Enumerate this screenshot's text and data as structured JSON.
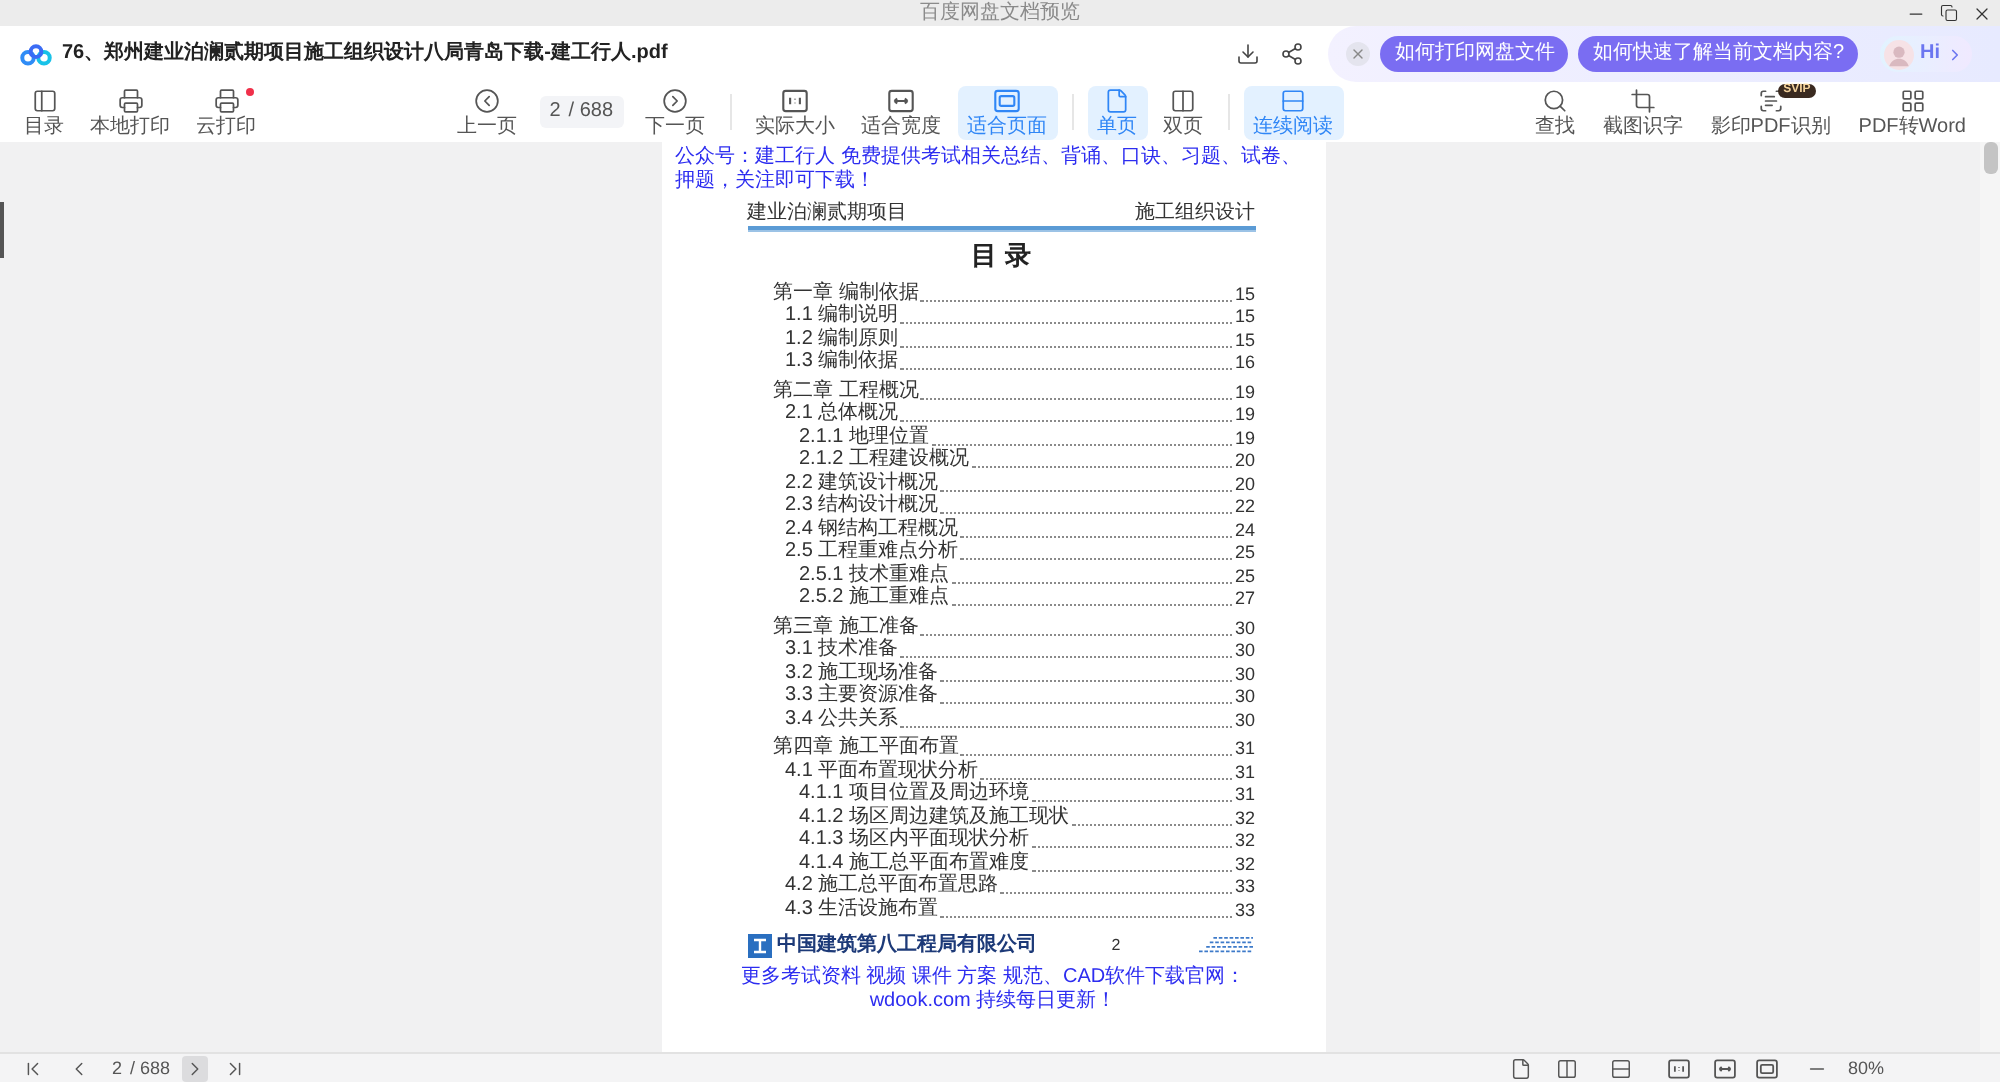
{
  "window": {
    "title": "百度网盘文档预览"
  },
  "header": {
    "file_name": "76、郑州建业泊澜贰期项目施工组织设计八局青岛下载-建工行人.pdf",
    "assistant": {
      "suggestions": [
        "如何打印网盘文件",
        "如何快速了解当前文档内容?"
      ],
      "greeting": "Hi"
    }
  },
  "toolbar": {
    "left": [
      {
        "label": "目录",
        "notification": false
      },
      {
        "label": "本地打印",
        "notification": false
      },
      {
        "label": "云打印",
        "notification": true
      }
    ],
    "navigation": {
      "previous": "上一页",
      "page": "2",
      "total": "/ 688",
      "next": "下一页"
    },
    "fit_modes": [
      {
        "label": "实际大小",
        "selected": false
      },
      {
        "label": "适合宽度",
        "selected": false
      },
      {
        "label": "适合页面",
        "selected": true
      }
    ],
    "page_modes": [
      {
        "label": "单页",
        "selected": true
      },
      {
        "label": "双页",
        "selected": false
      }
    ],
    "reading_modes": [
      {
        "label": "连续阅读",
        "selected": true
      }
    ],
    "right": [
      {
        "label": "查找"
      },
      {
        "label": "截图识字"
      },
      {
        "label": "影印PDF识别",
        "badge": "SVIP"
      },
      {
        "label": "PDF转Word"
      }
    ]
  },
  "document": {
    "top_notice": "公众号：建工行人 免费提供考试相关总结、背诵、口诀、习题、试卷、押题，关注即可下载！",
    "header_left": "建业泊澜贰期项目",
    "header_right": "施工组织设计",
    "title": "目 录",
    "toc": [
      {
        "title": "第一章 编制依据",
        "page": "15",
        "children": [
          {
            "title": "1.1 编制说明",
            "page": "15"
          },
          {
            "title": "1.2 编制原则",
            "page": "15"
          },
          {
            "title": "1.3 编制依据",
            "page": "16"
          }
        ]
      },
      {
        "title": "第二章 工程概况",
        "page": "19",
        "children": [
          {
            "title": "2.1 总体概况",
            "page": "19",
            "children": [
              {
                "title": "2.1.1 地理位置",
                "page": "19"
              },
              {
                "title": "2.1.2 工程建设概况",
                "page": "20"
              }
            ]
          },
          {
            "title": "2.2 建筑设计概况",
            "page": "20"
          },
          {
            "title": "2.3 结构设计概况",
            "page": "22"
          },
          {
            "title": "2.4 钢结构工程概况",
            "page": "24"
          },
          {
            "title": "2.5 工程重难点分析",
            "page": "25",
            "children": [
              {
                "title": "2.5.1 技术重难点",
                "page": "25"
              },
              {
                "title": "2.5.2 施工重难点",
                "page": "27"
              }
            ]
          }
        ]
      },
      {
        "title": "第三章 施工准备",
        "page": "30",
        "children": [
          {
            "title": "3.1 技术准备",
            "page": "30"
          },
          {
            "title": "3.2 施工现场准备",
            "page": "30"
          },
          {
            "title": "3.3 主要资源准备",
            "page": "30"
          },
          {
            "title": "3.4 公共关系",
            "page": "30"
          }
        ]
      },
      {
        "title": "第四章 施工平面布置",
        "page": "31",
        "children": [
          {
            "title": "4.1 平面布置现状分析",
            "page": "31",
            "children": [
              {
                "title": "4.1.1 项目位置及周边环境",
                "page": "31"
              },
              {
                "title": "4.1.2 场区周边建筑及施工现状",
                "page": "32"
              },
              {
                "title": "4.1.3 场区内平面现状分析",
                "page": "32"
              },
              {
                "title": "4.1.4 施工总平面布置难度",
                "page": "32"
              }
            ]
          },
          {
            "title": "4.2 施工总平面布置思路",
            "page": "33"
          },
          {
            "title": "4.3 生活设施布置",
            "page": "33"
          }
        ]
      }
    ],
    "footer": {
      "company": "中国建筑第八工程局有限公司",
      "page_number": "2"
    },
    "bottom_notice": "更多考试资料 视频 课件 方案 规范、CAD软件下载官网：wdook.com 持续每日更新！"
  },
  "status_bar": {
    "page": "2",
    "total": "/ 688",
    "next_highlighted": true,
    "zoom": "80%"
  }
}
